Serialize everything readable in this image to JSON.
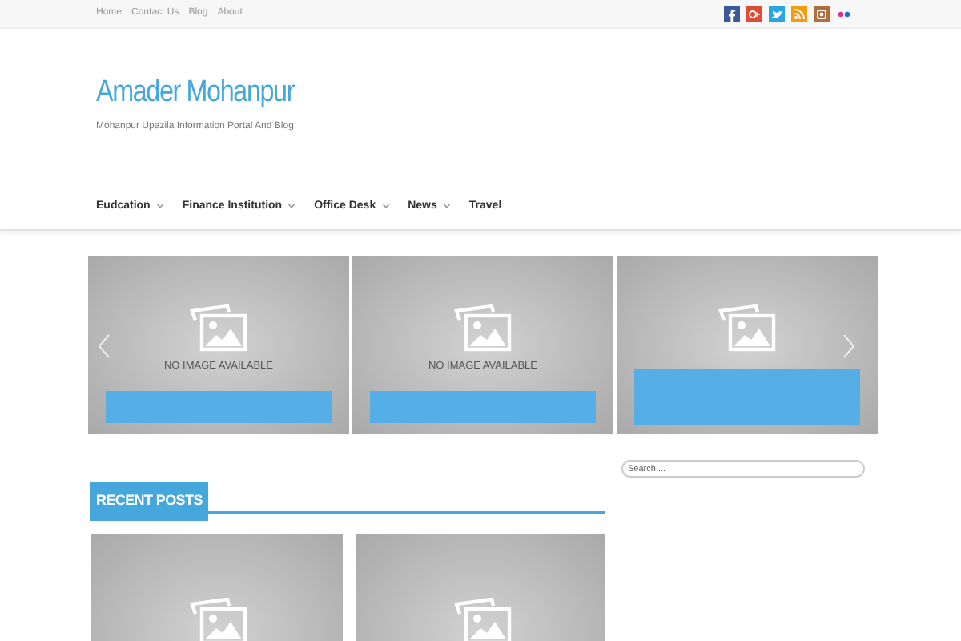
{
  "top_links": [
    "Home",
    "Contact Us",
    "Blog",
    "About"
  ],
  "social": [
    {
      "kind": "f",
      "color": "#3b5998"
    },
    {
      "kind": "g",
      "color": "#dd4b39"
    },
    {
      "kind": "bird",
      "color": "#2ba6de"
    },
    {
      "kind": "rss",
      "color": "#f39c12"
    },
    {
      "kind": "camera",
      "color": "#b0703c"
    },
    {
      "kind": "dots"
    }
  ],
  "site": {
    "title": "Amader Mohanpur",
    "tagline": "Mohanpur Upazila Information Portal And Blog"
  },
  "nav": [
    {
      "label": "Eudcation",
      "dropdown": true
    },
    {
      "label": "Finance Institution",
      "dropdown": true
    },
    {
      "label": "Office Desk",
      "dropdown": true
    },
    {
      "label": "News",
      "dropdown": true
    },
    {
      "label": "Travel",
      "dropdown": false
    }
  ],
  "slides": [
    {
      "caption": "NO IMAGE AVAILABLE",
      "bar_raised": false
    },
    {
      "caption": "NO IMAGE AVAILABLE",
      "bar_raised": false
    },
    {
      "bar_raised": true
    }
  ],
  "recent": {
    "title": "RECENT POSTS"
  },
  "search": {
    "placeholder": "Search ..."
  }
}
